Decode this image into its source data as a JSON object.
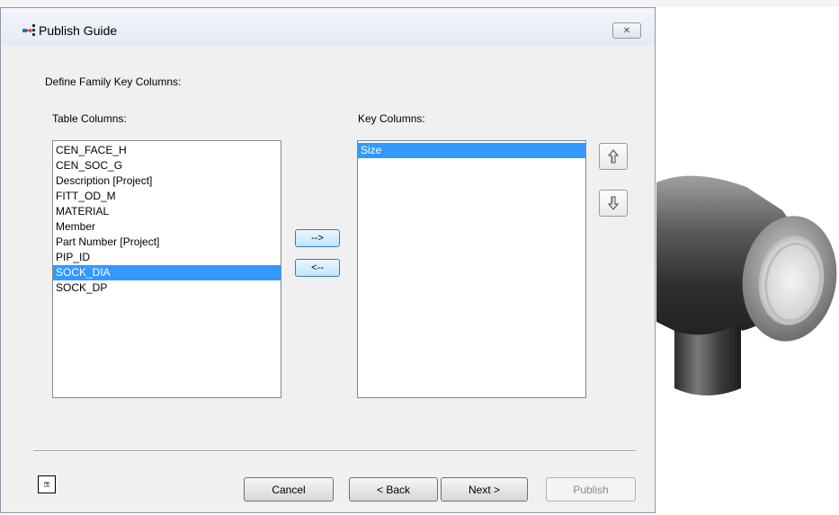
{
  "dialog": {
    "title": "Publish Guide",
    "close_glyph": "✕"
  },
  "section_title": "Define Family Key Columns:",
  "table_columns": {
    "label": "Table Columns:",
    "items": [
      {
        "label": "CEN_FACE_H",
        "selected": false
      },
      {
        "label": "CEN_SOC_G",
        "selected": false
      },
      {
        "label": "Description [Project]",
        "selected": false
      },
      {
        "label": "FITT_OD_M",
        "selected": false
      },
      {
        "label": "MATERIAL",
        "selected": false
      },
      {
        "label": "Member",
        "selected": false
      },
      {
        "label": "Part Number [Project]",
        "selected": false
      },
      {
        "label": "PIP_ID",
        "selected": false
      },
      {
        "label": "SOCK_DIA",
        "selected": true
      },
      {
        "label": "SOCK_DP",
        "selected": false
      }
    ]
  },
  "key_columns": {
    "label": "Key Columns:",
    "items": [
      {
        "label": "Size",
        "selected": true
      }
    ]
  },
  "transfer": {
    "add_label": "-->",
    "remove_label": "<--"
  },
  "move_buttons": {
    "up_icon": "arrow-up-icon",
    "down_icon": "arrow-down-icon"
  },
  "footer": {
    "help_icon": "help-icon",
    "cancel_label": "Cancel",
    "back_label": "< Back",
    "next_label": "Next >",
    "publish_label": "Publish"
  },
  "colors": {
    "selection": "#3399ff",
    "dialog_bg": "#f0f0f0",
    "arrow_button": "#bee6fd"
  }
}
